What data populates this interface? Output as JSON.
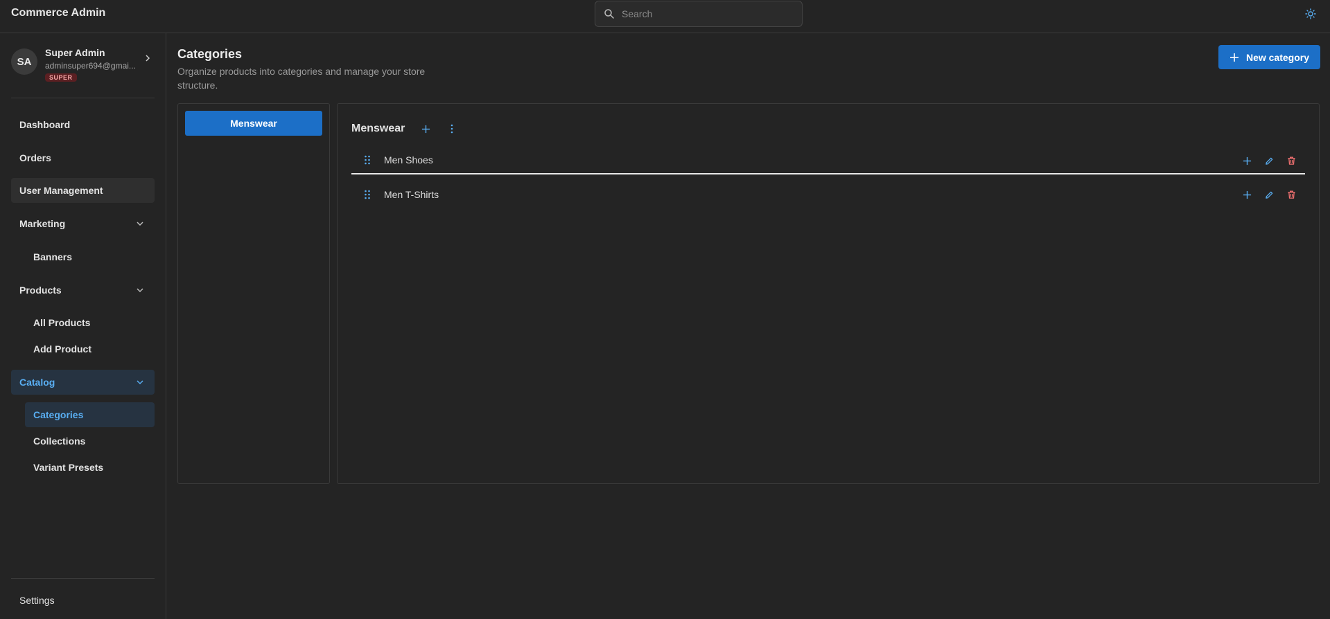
{
  "app": {
    "title": "Commerce Admin"
  },
  "search": {
    "placeholder": "Search"
  },
  "profile": {
    "initials": "SA",
    "name": "Super Admin",
    "email": "adminsuper694@gmai...",
    "badge": "SUPER"
  },
  "nav": {
    "dashboard": "Dashboard",
    "orders": "Orders",
    "user_management": "User Management",
    "marketing": "Marketing",
    "banners": "Banners",
    "products": "Products",
    "all_products": "All Products",
    "add_product": "Add Product",
    "catalog": "Catalog",
    "categories": "Categories",
    "collections": "Collections",
    "variant_presets": "Variant Presets",
    "settings": "Settings"
  },
  "page": {
    "title": "Categories",
    "subtitle": "Organize products into categories and manage your store structure.",
    "new_button": "New category"
  },
  "tree": {
    "root_categories": [
      "Menswear"
    ],
    "selected": "Menswear",
    "children": [
      {
        "label": "Men Shoes"
      },
      {
        "label": "Men T-Shirts"
      }
    ]
  },
  "colors": {
    "accent": "#1c6fc7",
    "active_text": "#59aef2",
    "delete": "#f07070",
    "background": "#242424"
  },
  "icons": {
    "search": "search-icon",
    "theme": "sun-icon",
    "add": "plus-icon",
    "more": "more-vertical-icon",
    "drag": "drag-handle-icon",
    "edit": "pencil-icon",
    "delete": "trash-icon",
    "chevron": "chevron-down-icon"
  }
}
